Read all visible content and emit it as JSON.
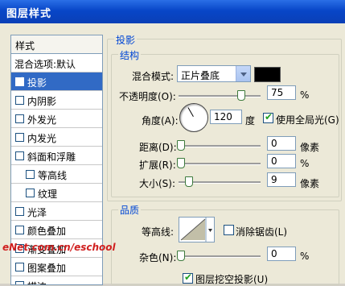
{
  "window": {
    "title": "图层样式"
  },
  "sidebar": {
    "header": "样式",
    "items": [
      {
        "label": "混合选项:默认",
        "checkbox": false,
        "checked": false
      },
      {
        "label": "投影",
        "checkbox": true,
        "checked": true,
        "selected": true
      },
      {
        "label": "内阴影",
        "checkbox": true,
        "checked": false
      },
      {
        "label": "外发光",
        "checkbox": true,
        "checked": false
      },
      {
        "label": "内发光",
        "checkbox": true,
        "checked": false
      },
      {
        "label": "斜面和浮雕",
        "checkbox": true,
        "checked": false
      },
      {
        "label": "等高线",
        "checkbox": true,
        "checked": false,
        "sub": true
      },
      {
        "label": "纹理",
        "checkbox": true,
        "checked": false,
        "sub": true
      },
      {
        "label": "光泽",
        "checkbox": true,
        "checked": false
      },
      {
        "label": "颜色叠加",
        "checkbox": true,
        "checked": false
      },
      {
        "label": "渐变叠加",
        "checkbox": true,
        "checked": false
      },
      {
        "label": "图案叠加",
        "checkbox": true,
        "checked": false
      },
      {
        "label": "描边",
        "checkbox": true,
        "checked": false
      }
    ]
  },
  "section": {
    "title": "投影"
  },
  "structure": {
    "title": "结构",
    "blend_mode_label": "混合模式:",
    "blend_mode_value": "正片叠底",
    "shadow_color": "#000000",
    "opacity_label": "不透明度(O):",
    "opacity_value": "75",
    "opacity_unit": "%",
    "opacity_level": 0.75,
    "angle_label": "角度(A):",
    "angle_value": "120",
    "angle_unit": "度",
    "global_light_label": "使用全局光(G)",
    "global_light_checked": true,
    "distance_label": "距离(D):",
    "distance_value": "0",
    "distance_unit": "像素",
    "spread_label": "扩展(R):",
    "spread_value": "0",
    "spread_unit": "%",
    "size_label": "大小(S):",
    "size_value": "9",
    "size_unit": "像素"
  },
  "quality": {
    "title": "品质",
    "contour_label": "等高线:",
    "antialias_label": "消除锯齿(L)",
    "antialias_checked": false,
    "noise_label": "杂色(N):",
    "noise_value": "0",
    "noise_unit": "%",
    "knockout_label": "图层挖空投影(U)",
    "knockout_checked": true
  },
  "watermark": {
    "text": "eNet.com.cn/eschool"
  }
}
